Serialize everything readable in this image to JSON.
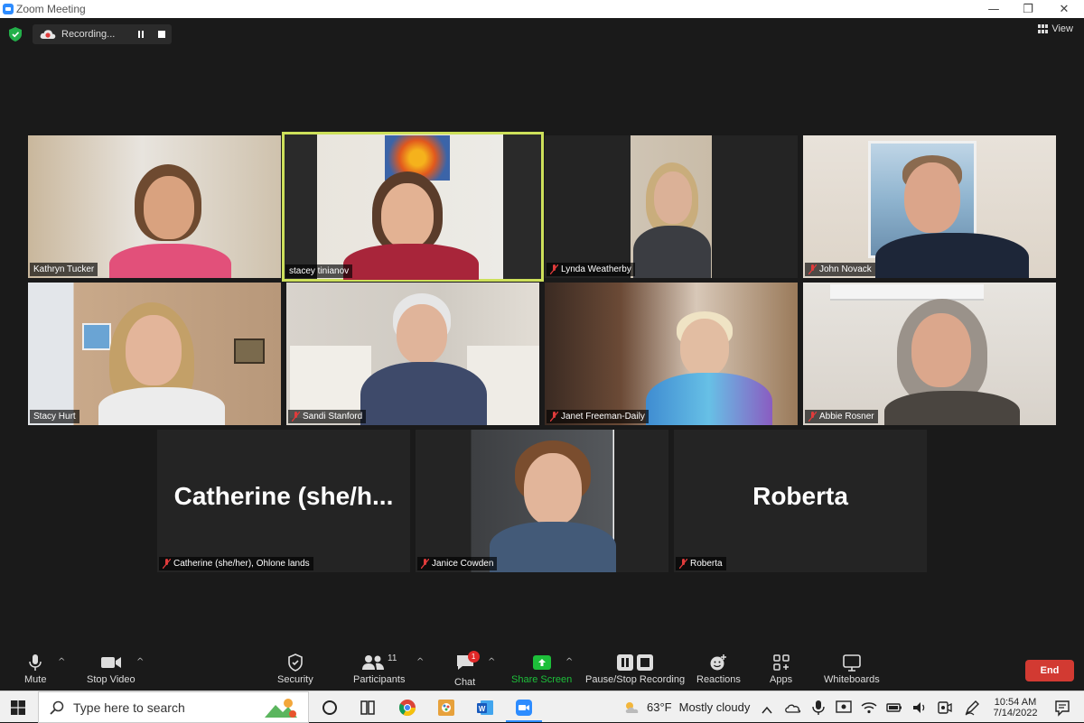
{
  "window": {
    "title": "Zoom Meeting"
  },
  "recording": {
    "status": "Recording..."
  },
  "view": {
    "label": "View"
  },
  "participants": [
    {
      "name": "Kathryn Tucker",
      "muted": false,
      "active": false
    },
    {
      "name": "stacey tinianov",
      "muted": false,
      "active": true
    },
    {
      "name": "Lynda Weatherby",
      "muted": true,
      "active": false
    },
    {
      "name": "John Novack",
      "muted": true,
      "active": false
    },
    {
      "name": "Stacy Hurt",
      "muted": false,
      "active": false
    },
    {
      "name": "Sandi Stanford",
      "muted": true,
      "active": false
    },
    {
      "name": "Janet Freeman-Daily",
      "muted": true,
      "active": false
    },
    {
      "name": "Abbie Rosner",
      "muted": true,
      "active": false
    },
    {
      "name": "Catherine (she/her), Ohlone lands",
      "display": "Catherine  (she/h...",
      "muted": true,
      "active": false
    },
    {
      "name": "Janice Cowden",
      "muted": true,
      "active": false
    },
    {
      "name": "Roberta",
      "display": "Roberta",
      "muted": true,
      "active": false
    }
  ],
  "toolbar": {
    "mute": "Mute",
    "stop_video": "Stop Video",
    "security": "Security",
    "participants": "Participants",
    "participants_count": "11",
    "chat": "Chat",
    "chat_badge": "1",
    "share_screen": "Share Screen",
    "recording": "Pause/Stop Recording",
    "reactions": "Reactions",
    "apps": "Apps",
    "whiteboards": "Whiteboards",
    "end": "End"
  },
  "taskbar": {
    "search_placeholder": "Type here to search",
    "weather_temp": "63°F",
    "weather_desc": "Mostly cloudy",
    "time": "10:54 AM",
    "date": "7/14/2022"
  },
  "colors": {
    "active_speaker": "#cde05a",
    "share_green": "#1dbf3a",
    "end_red": "#d23a32",
    "zoom_blue": "#2d8cff"
  }
}
